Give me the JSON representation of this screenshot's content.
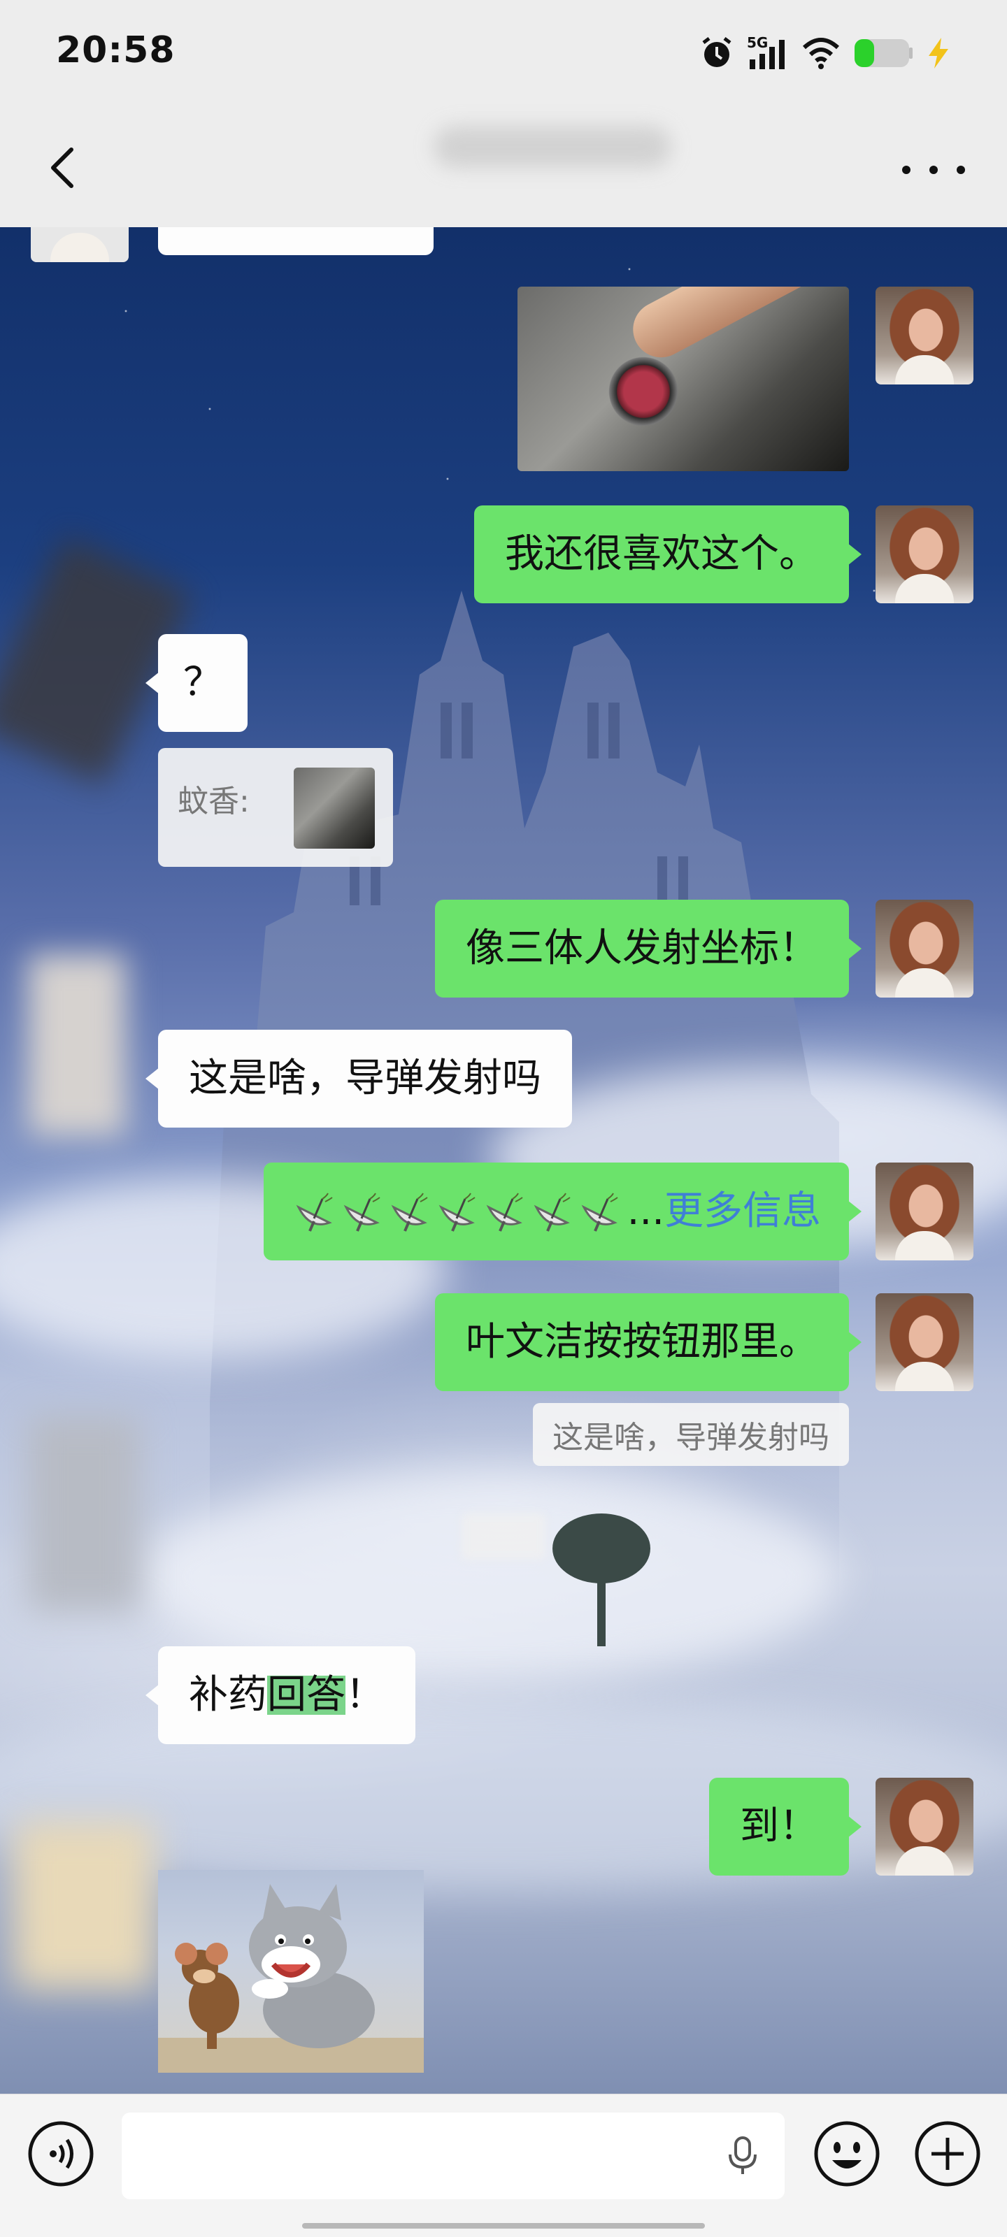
{
  "status_bar": {
    "time": "20:58",
    "icons": [
      "alarm-icon",
      "5g-signal-icon",
      "wifi-icon",
      "battery-icon",
      "charging-icon"
    ],
    "network_label": "5G"
  },
  "header": {
    "back_icon": "chevron-left-icon",
    "more_icon": "more-dots-icon"
  },
  "messages": [
    {
      "id": 1,
      "side": "right",
      "type": "image",
      "image": "red-button-photo"
    },
    {
      "id": 2,
      "side": "right",
      "type": "text",
      "text": "我还很喜欢这个。"
    },
    {
      "id": 3,
      "side": "left",
      "type": "text",
      "text": "？"
    },
    {
      "id": 4,
      "side": "left",
      "type": "quote",
      "quote_sender": "蚊香:",
      "quote_image": "red-button-photo"
    },
    {
      "id": 5,
      "side": "right",
      "type": "text",
      "text": "像三体人发射坐标！"
    },
    {
      "id": 6,
      "side": "left",
      "type": "text",
      "text": "这是啥，导弹发射吗"
    },
    {
      "id": 7,
      "side": "right",
      "type": "text",
      "emoji_count": 7,
      "emoji": "satellite-antenna-icon",
      "ellipsis": "...",
      "more_label": "更多信息"
    },
    {
      "id": 8,
      "side": "right",
      "type": "text",
      "text": "叶文洁按按钮那里。",
      "quote": "这是啥，导弹发射吗"
    },
    {
      "id": 9,
      "side": "left",
      "type": "text",
      "text_before": "补药",
      "highlight": "回答",
      "text_after": "！"
    },
    {
      "id": 10,
      "side": "right",
      "type": "text",
      "text": "到！"
    },
    {
      "id": 11,
      "side": "left",
      "type": "sticker",
      "image": "cartoon-cat-mouse-sticker"
    }
  ],
  "input_bar": {
    "voice_icon": "voice-mode-icon",
    "mic_icon": "microphone-icon",
    "emoji_icon": "emoji-smile-icon",
    "plus_icon": "add-plus-icon"
  },
  "colors": {
    "sent_bubble": "#6be36b",
    "received_bubble": "#fdfdfd",
    "link": "#3f7fd6",
    "highlight": "#7bd48a"
  }
}
